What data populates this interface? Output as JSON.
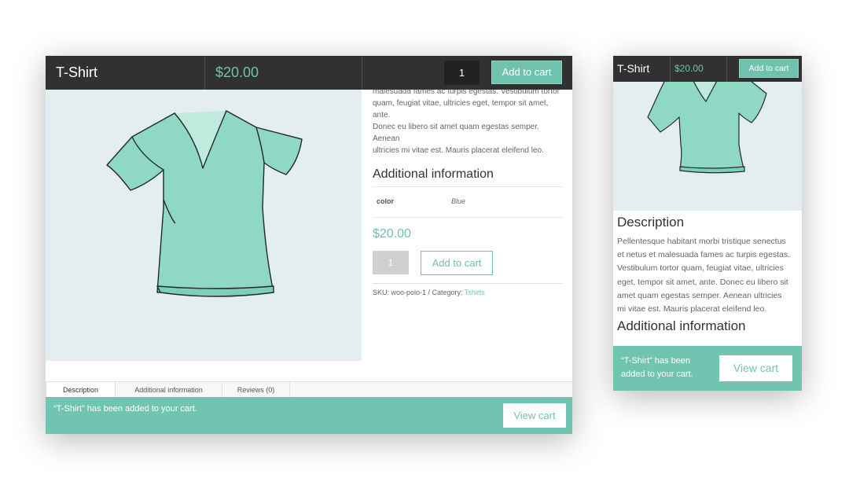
{
  "product": {
    "title": "T-Shirt",
    "price": "$20.00",
    "quantity": "1",
    "add_to_cart_label": "Add to cart",
    "color_accent": "#6fc2ad"
  },
  "desktop": {
    "desc_lines": [
      "malesuada fames ac turpis egestas. Vestibulum tortor",
      "quam, feugiat vitae, ultricies eget, tempor sit amet, ante.",
      "Donec eu libero sit amet quam egestas semper. Aenean",
      "ultricies mi vitae est. Mauris placerat eleifend leo."
    ],
    "additional_info_heading": "Additional information",
    "attr_name": "color",
    "attr_value": "Blue",
    "price": "$20.00",
    "qty_value": "1",
    "add_to_cart_label": "Add to cart",
    "sku_text": "SKU: woo-polo-1 / Category: ",
    "category_link": "Tshirts",
    "tabs": [
      "Description",
      "Additional information",
      "Reviews (0)"
    ],
    "notice_text": "“T-Shirt” has been added to your cart.",
    "view_cart_label": "View cart"
  },
  "mobile": {
    "description_heading": "Description",
    "desc_lines": [
      "Pellentesque habitant morbi tristique senectus",
      "et netus et malesuada fames ac turpis egestas.",
      "Vestibulum tortor quam, feugiat vitae, ultricies",
      "eget, tempor sit amet, ante. Donec eu libero sit",
      "amet quam egestas semper. Aenean ultricies",
      "mi vitae est. Mauris placerat eleifend leo."
    ],
    "additional_info_heading": "Additional information",
    "notice_line1": "“T-Shirt” has been",
    "notice_line2": "added to your cart.",
    "view_cart_label": "View cart"
  }
}
